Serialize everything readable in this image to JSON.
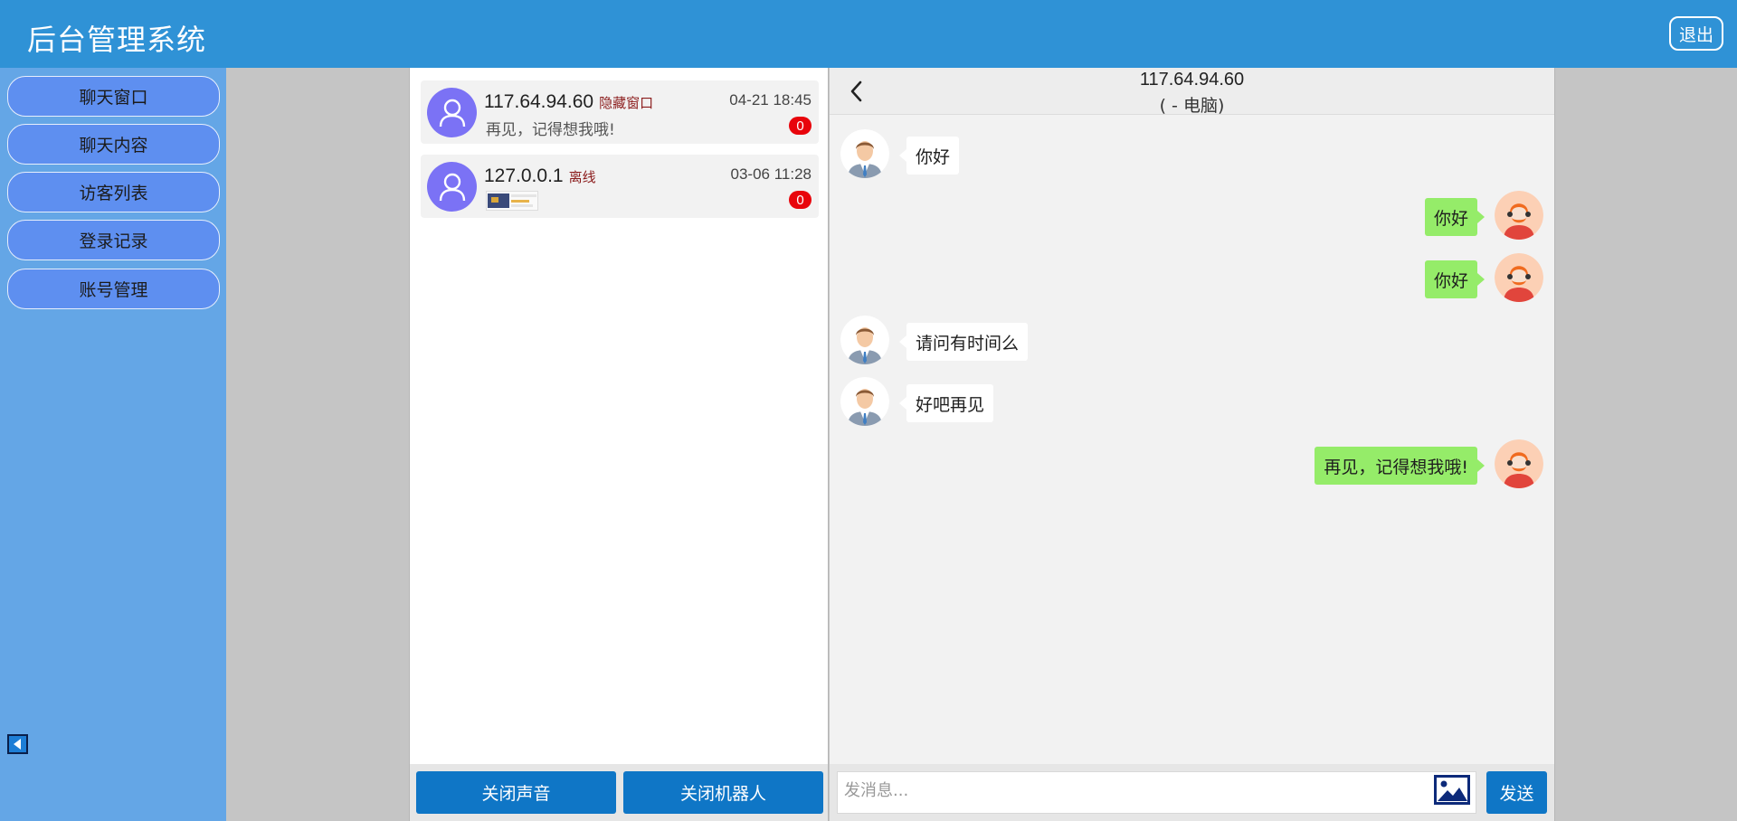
{
  "header": {
    "title": "后台管理系统",
    "logout_label": "退出"
  },
  "sidebar": {
    "items": [
      {
        "label": "聊天窗口"
      },
      {
        "label": "聊天内容"
      },
      {
        "label": "访客列表"
      },
      {
        "label": "登录记录"
      },
      {
        "label": "账号管理"
      }
    ],
    "collapse_icon": "triangle-left-icon"
  },
  "conversations": [
    {
      "ip": "117.64.94.60",
      "tag": "隐藏窗口",
      "time": "04-21 18:45",
      "preview": "再见，记得想我哦!",
      "unread": "0"
    },
    {
      "ip": "127.0.0.1",
      "tag": "离线",
      "time": "03-06 11:28",
      "preview_type": "image-thumbnail",
      "unread": "0"
    }
  ],
  "conversation_footer": {
    "mute_label": "关闭声音",
    "robot_label": "关闭机器人"
  },
  "chat": {
    "ip": "117.64.94.60",
    "device": "( - 电脑)",
    "messages": [
      {
        "side": "visitor",
        "text": "你好"
      },
      {
        "side": "agent",
        "text": "你好"
      },
      {
        "side": "agent",
        "text": "你好"
      },
      {
        "side": "visitor",
        "text": "请问有时间么"
      },
      {
        "side": "visitor",
        "text": "好吧再见"
      },
      {
        "side": "agent",
        "text": "再见，记得想我哦!"
      }
    ],
    "input_placeholder": "发消息...",
    "send_label": "发送"
  },
  "colors": {
    "header": "#2f92d6",
    "sidebar": "#64a6e6",
    "nav_button": "#5e8ff0",
    "primary_button": "#0f76c6",
    "agent_bubble": "#95ec69",
    "unread_badge": "#e8040b",
    "visitor_avatar": "#7b72f5"
  }
}
